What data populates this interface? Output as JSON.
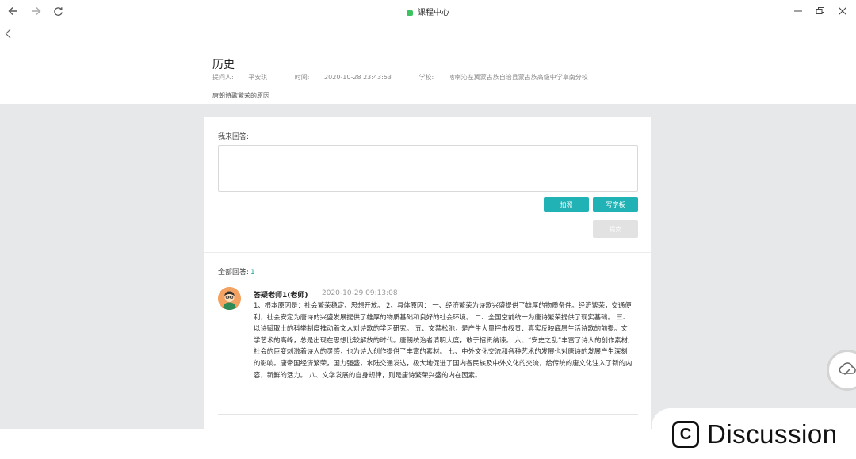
{
  "window": {
    "title": "课程中心",
    "accent": "#3cc35f"
  },
  "nav": {
    "back_icon": "arrow-left-icon",
    "forward_icon": "arrow-right-icon",
    "refresh_icon": "refresh-icon",
    "minimize_icon": "minimize-icon",
    "restore_icon": "restore-icon",
    "close_icon": "close-icon"
  },
  "question": {
    "subject": "历史",
    "asker_label": "提问人:",
    "asker": "平安琪",
    "time_label": "时间:",
    "time": "2020-10-28  23:43:53",
    "school_label": "学校:",
    "school": "喀喇沁左翼蒙古族自治县蒙古族高级中学卓南分校",
    "text": "唐朝诗歌繁荣的原因"
  },
  "answer_form": {
    "label": "我来回答:",
    "input_value": "",
    "photo_button": "拍照",
    "board_button": "写字板",
    "submit_button": "提交",
    "accent": "#20b2b5"
  },
  "answers": {
    "label": "全部回答:",
    "count": "1",
    "items": [
      {
        "author": "答疑老师1(老师)",
        "time": "2020-10-29  09:13:08",
        "body": "1、根本原因是：社会繁荣稳定、思想开放。 2、具体原因： 一、经济繁荣为诗歌兴盛提供了雄厚的物质条件。经济繁荣，交通便利，社会安定为唐诗的兴盛发展提供了雄厚的物质基础和良好的社会环境。 二、全国空前统一为唐诗繁荣提供了现实基础。 三、以诗赋取士的科举制度推动着文人对诗歌的学习研究。 五、文禁松弛，是产生大量抨击权贵、真实反映底层生活诗歌的前提。文学艺术的高峰，总是出现在思想比较解放的时代。唐朝统治者清明大度，敢于招贤纳谏。 六、“安史之乱”丰富了诗人的创作素材,社会的巨变刺激着诗人的灵感，也为诗人创作提供了丰富的素材。 七、中外文化交流和各种艺术的发展也对唐诗的发展产生深刻的影响。唐帝国经济繁荣，国力强盛，水陆交通发达，极大地促进了国内各民族及中外文化的交流，给传统的唐文化注入了新的内容，新鲜的活力。 八、文学发展的自身规律，则是唐诗繁荣兴盛的内在因素。"
      }
    ]
  },
  "floating_button": {
    "icon": "cloud-icon"
  },
  "watermark": {
    "logo_letter": "C",
    "text": "Discussion"
  }
}
